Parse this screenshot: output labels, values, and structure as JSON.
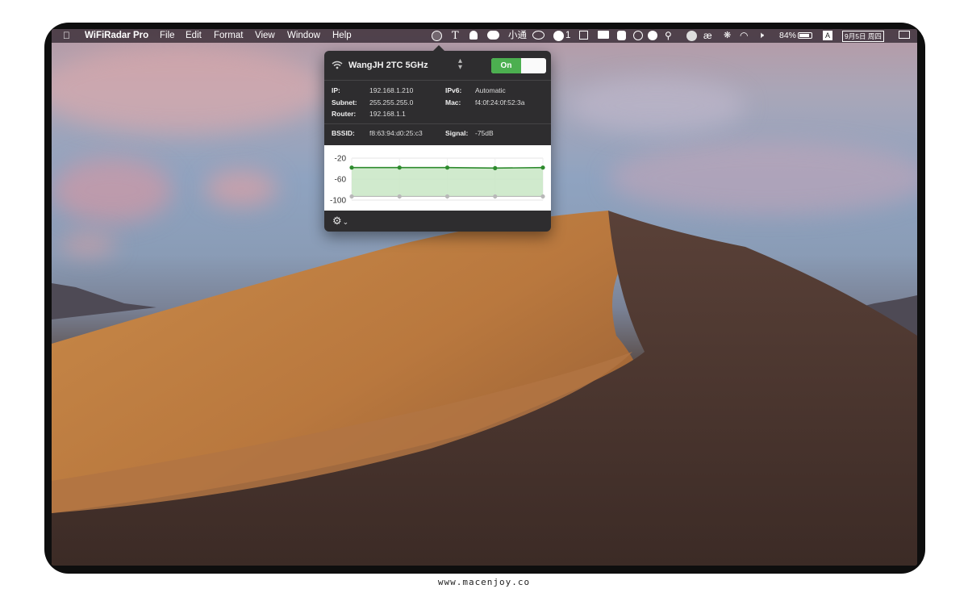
{
  "menubar": {
    "apple_icon": "apple-icon",
    "app_name": "WiFiRadar Pro",
    "menus": [
      "File",
      "Edit",
      "Format",
      "View",
      "Window",
      "Help"
    ],
    "status_text_xiaotong": "小通",
    "status_count": "1",
    "battery": "84%",
    "input_source": "A",
    "date": "9月5日 周四"
  },
  "popup": {
    "network_name": "WangJH 2TC 5GHz",
    "toggle_label": "On",
    "info": {
      "ip_label": "IP:",
      "ip_value": "192.168.1.210",
      "ipv6_label": "IPv6:",
      "ipv6_value": "Automatic",
      "subnet_label": "Subnet:",
      "subnet_value": "255.255.255.0",
      "mac_label": "Mac:",
      "mac_value": "f4:0f:24:0f:52:3a",
      "router_label": "Router:",
      "router_value": "192.168.1.1",
      "bssid_label": "BSSID:",
      "bssid_value": "f8:63:94:d0:25:c3",
      "signal_label": "Signal:",
      "signal_value": "-75dB"
    },
    "footer": {
      "gear_icon": "gear-icon",
      "chevron": "⌄"
    }
  },
  "chart_data": {
    "type": "line",
    "y_ticks": [
      "-20",
      "-60",
      "-100"
    ],
    "ylim": [
      -100,
      -20
    ],
    "series": [
      {
        "values": [
          -38,
          -38,
          -38,
          -39,
          -38
        ],
        "color": "#2e8b2e"
      },
      {
        "values": [
          -93,
          -93,
          -93,
          -93,
          -93
        ],
        "color": "#b8b8b8"
      }
    ],
    "fill": "#c8e6c4",
    "grid": true
  },
  "watermark": "www.macenjoy.co"
}
